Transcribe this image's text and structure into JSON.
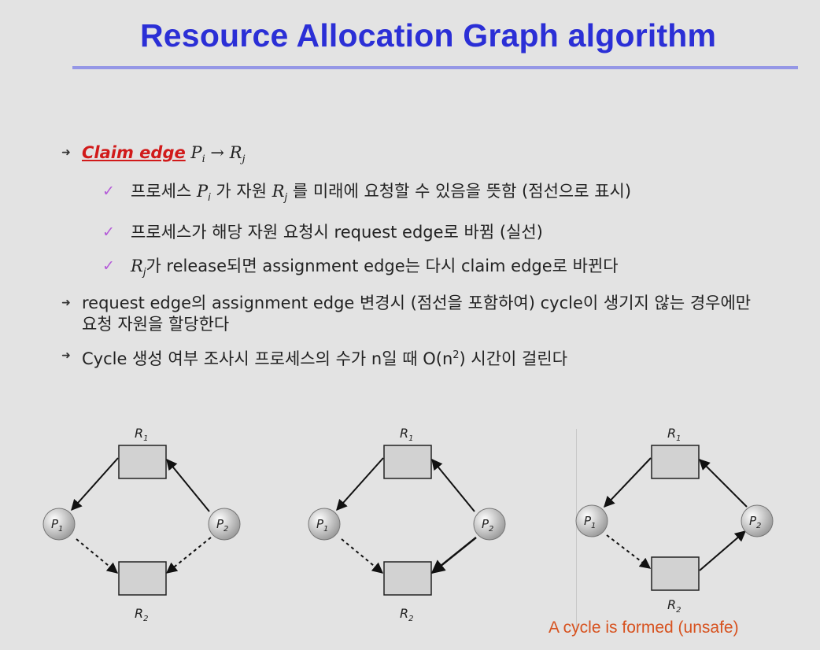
{
  "title": "Resource Allocation Graph algorithm",
  "bullets": {
    "b1": {
      "claim_label": "Claim edge",
      "p": "P",
      "p_sub": "i",
      "arrow": "→",
      "r": "R",
      "r_sub": "j"
    },
    "b1_sub": [
      {
        "pre": "프로세스 ",
        "p": "P",
        "p_sub": "i",
        "mid": " 가 자원 ",
        "r": "R",
        "r_sub": "j",
        "post": " 를 미래에 요청할 수 있음을 뜻함 (점선으로 표시)"
      },
      {
        "text": "프로세스가 해당 자원 요청시 request edge로 바뀜 (실선)"
      },
      {
        "r": "R",
        "r_sub": "j",
        "post": "가 release되면  assignment edge는 다시 claim edge로 바뀐다"
      }
    ],
    "b2": "request edge의 assignment edge 변경시 (점선을 포함하여) cycle이 생기지 않는 경우에만 요청 자원을 할당한다",
    "b3": {
      "pre": "Cycle 생성 여부 조사시 프로세스의 수가 n일 때 O(n",
      "sup": "2",
      "post": ") 시간이 걸린다"
    }
  },
  "graph_labels": {
    "R": "R",
    "P": "P",
    "one": "1",
    "two": "2"
  },
  "caption": "A cycle is formed (unsafe)"
}
